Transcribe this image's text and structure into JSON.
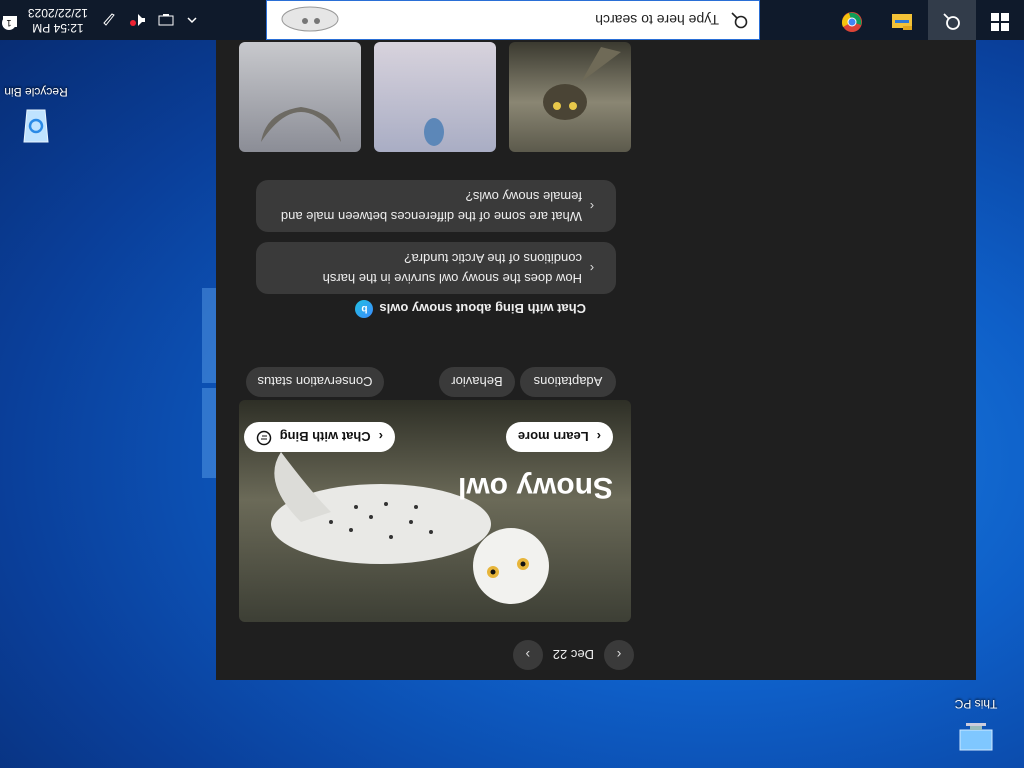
{
  "desktop": {
    "icons": [
      {
        "label": "This PC"
      },
      {
        "label": "Recycle Bin"
      }
    ]
  },
  "taskbar": {
    "search_placeholder": "Type here to search",
    "tray": {
      "time": "12:54 PM",
      "date": "12/22/2023",
      "notification_count": "1"
    }
  },
  "panel": {
    "date_label": "Dec 22",
    "hero": {
      "title": "Snowy owl",
      "learn_more_label": "Learn more",
      "chat_label": "Chat with Bing"
    },
    "chips": [
      "Adaptations",
      "Behavior",
      "Conservation status"
    ],
    "chat_section_title": "Chat with Bing about snowy owls",
    "questions": [
      "How does the snowy owl survive in the harsh conditions of the Arctic tundra?",
      "What are some of the differences between male and female snowy owls?"
    ]
  },
  "colors": {
    "desktop_bg": "#0e5fc8",
    "taskbar_bg": "#0f1a2b",
    "panel_bg": "#1f1f1f",
    "accent": "#2a6fd6"
  },
  "icons": [
    "windows-logo-icon",
    "search-icon",
    "file-explorer-icon",
    "chrome-icon",
    "chevron-up-icon",
    "network-icon",
    "battery-icon",
    "volume-muted-icon",
    "pen-icon",
    "notification-icon"
  ]
}
